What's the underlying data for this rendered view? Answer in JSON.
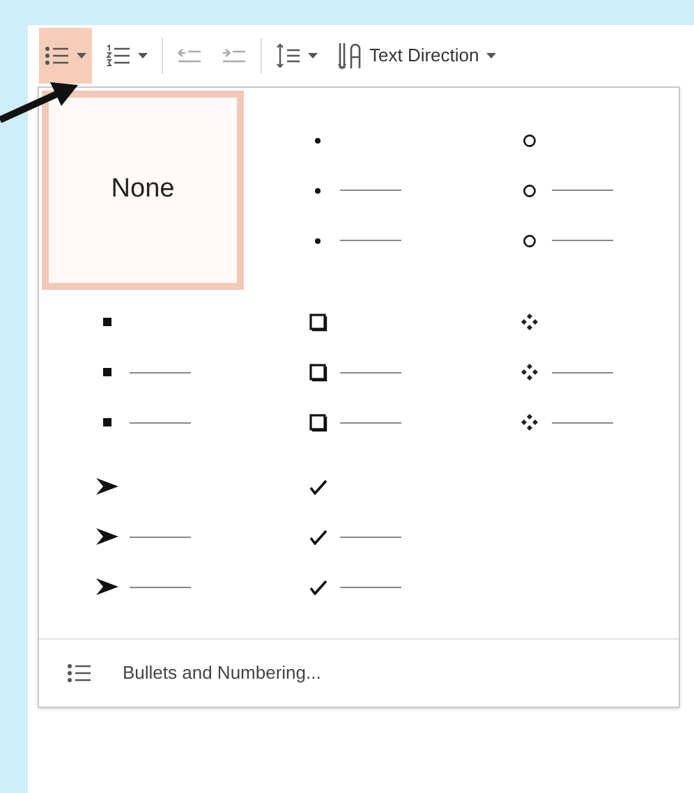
{
  "toolbar": [
    {
      "kind": "bullets",
      "selected": true,
      "dropdown": true
    },
    {
      "kind": "numbering",
      "selected": false,
      "dropdown": true
    },
    {
      "kind": "decrease-indent",
      "selected": false,
      "dropdown": false
    },
    {
      "kind": "increase-indent",
      "selected": false,
      "dropdown": false
    },
    {
      "kind": "line-spacing",
      "selected": false,
      "dropdown": true
    },
    {
      "kind": "text-direction",
      "selected": false,
      "dropdown": true,
      "label": "Text Direction"
    }
  ],
  "bullet_library": [
    {
      "kind": "none",
      "label": "None",
      "selected": true
    },
    {
      "kind": "dot",
      "selected": false
    },
    {
      "kind": "circle",
      "selected": false
    },
    {
      "kind": "square",
      "selected": false
    },
    {
      "kind": "hollow-square",
      "selected": false
    },
    {
      "kind": "diamond",
      "selected": false
    },
    {
      "kind": "arrow",
      "selected": false
    },
    {
      "kind": "check",
      "selected": false
    }
  ],
  "menu_item": {
    "label": "Bullets and Numbering..."
  }
}
